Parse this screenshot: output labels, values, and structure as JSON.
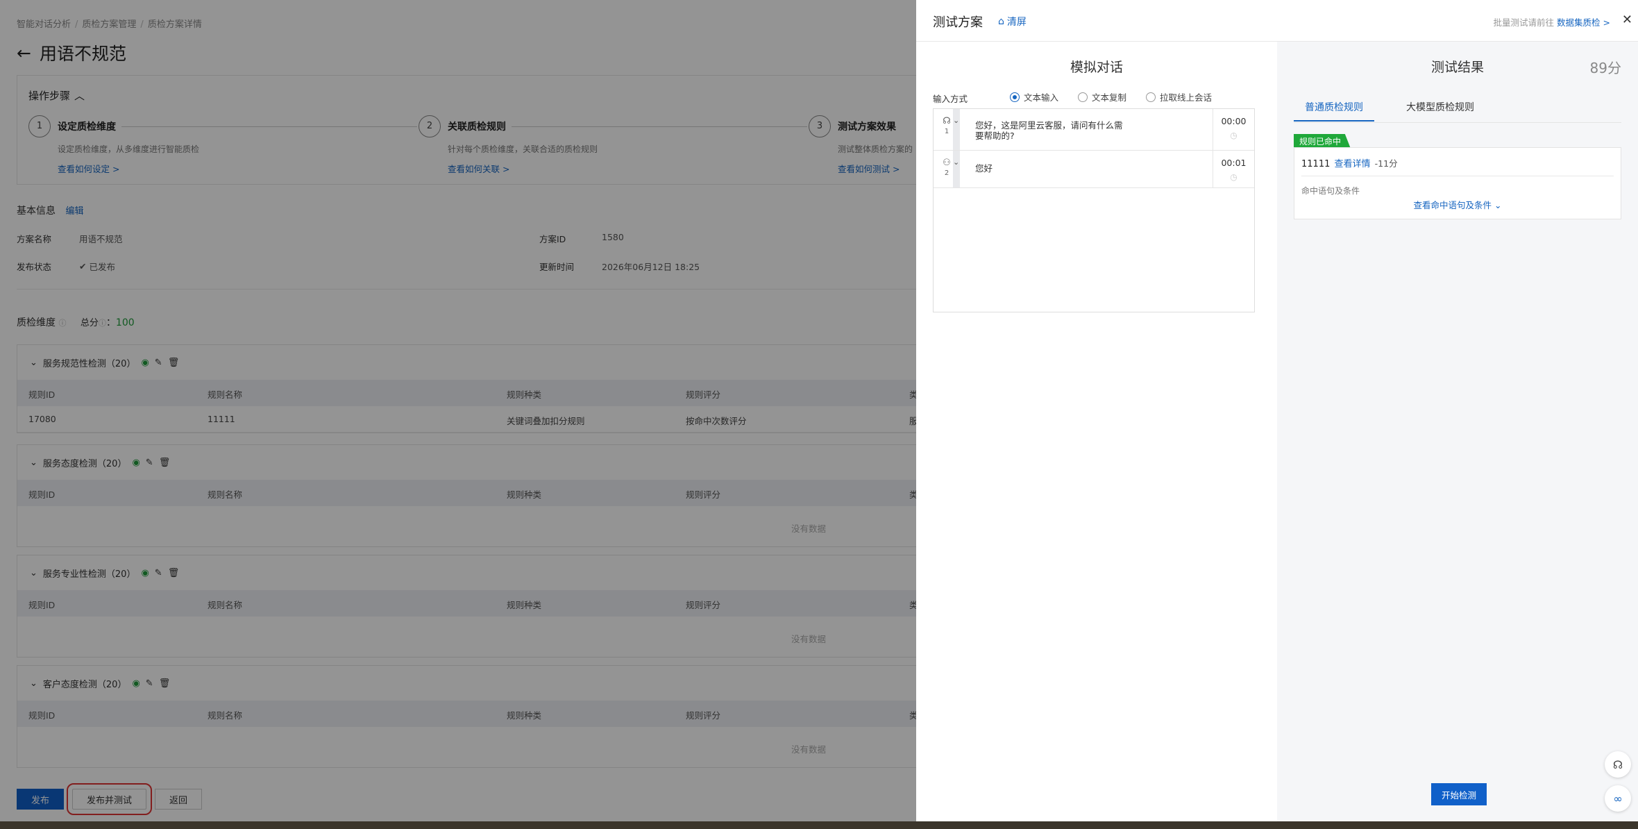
{
  "breadcrumb": [
    "智能对话分析",
    "质检方案管理",
    "质检方案详情"
  ],
  "page_title": "用语不规范",
  "steps": {
    "header": "操作步骤",
    "items": [
      {
        "num": "1",
        "title": "设定质检维度",
        "desc": "设定质检维度，从多维度进行智能质检",
        "link": "查看如何设定 >"
      },
      {
        "num": "2",
        "title": "关联质检规则",
        "desc": "针对每个质检维度，关联合适的质检规则",
        "link": "查看如何关联 >"
      },
      {
        "num": "3",
        "title": "测试方案效果",
        "desc": "测试整体质检方案的",
        "link": "查看如何测试 >"
      }
    ]
  },
  "basic_info": {
    "label": "基本信息",
    "edit": "编辑",
    "name_key": "方案名称",
    "name_val": "用语不规范",
    "id_key": "方案ID",
    "id_val": "1580",
    "status_key": "发布状态",
    "status_val": "已发布",
    "time_key": "更新时间",
    "time_val": "2026年06月12日 18:25"
  },
  "dimension": {
    "label": "质检维度",
    "total_label": "总分",
    "total_sep": "：",
    "total_val": "100"
  },
  "table_headers": [
    "规则ID",
    "规则名称",
    "规则种类",
    "规则评分",
    "类"
  ],
  "groups": [
    {
      "title": "服务规范性检测（20）",
      "rows": [
        [
          "17080",
          "11111",
          "关键词叠加扣分规则",
          "按命中次数评分",
          "服"
        ]
      ]
    },
    {
      "title": "服务态度检测（20）",
      "rows": []
    },
    {
      "title": "服务专业性检测（20）",
      "rows": []
    },
    {
      "title": "客户态度检测（20）",
      "rows": []
    }
  ],
  "empty_text": "没有数据",
  "bottom_buttons": {
    "publish": "发布",
    "publish_test": "发布并测试",
    "back": "返回"
  },
  "drawer": {
    "title": "测试方案",
    "clear": "清屏",
    "batch_text": "批量测试请前往",
    "batch_link": "数据集质检 >",
    "close": "✕"
  },
  "sim": {
    "title": "模拟对话",
    "input_mode": "输入方式",
    "options": [
      "文本输入",
      "文本复制",
      "拉取线上会话"
    ],
    "selected": "文本输入",
    "messages": [
      {
        "idx": "1",
        "role": "agent",
        "text": "您好，这是阿里云客服，请问有什么需要帮助的?",
        "time": "00:00"
      },
      {
        "idx": "2",
        "role": "customer",
        "text": "您好",
        "time": "00:01"
      }
    ]
  },
  "result": {
    "title": "测试结果",
    "score": "89分",
    "tabs": [
      "普通质检规则",
      "大模型质检规则"
    ],
    "badge": "规则已命中",
    "rule_id": "11111",
    "detail_link": "查看详情",
    "rule_score": "-11分",
    "cond_label": "命中语句及条件",
    "more": "查看命中语句及条件"
  },
  "start_button": "开始检测",
  "colors": {
    "primary": "#1060c9",
    "success": "#1fa83a",
    "link": "#1665c0"
  }
}
